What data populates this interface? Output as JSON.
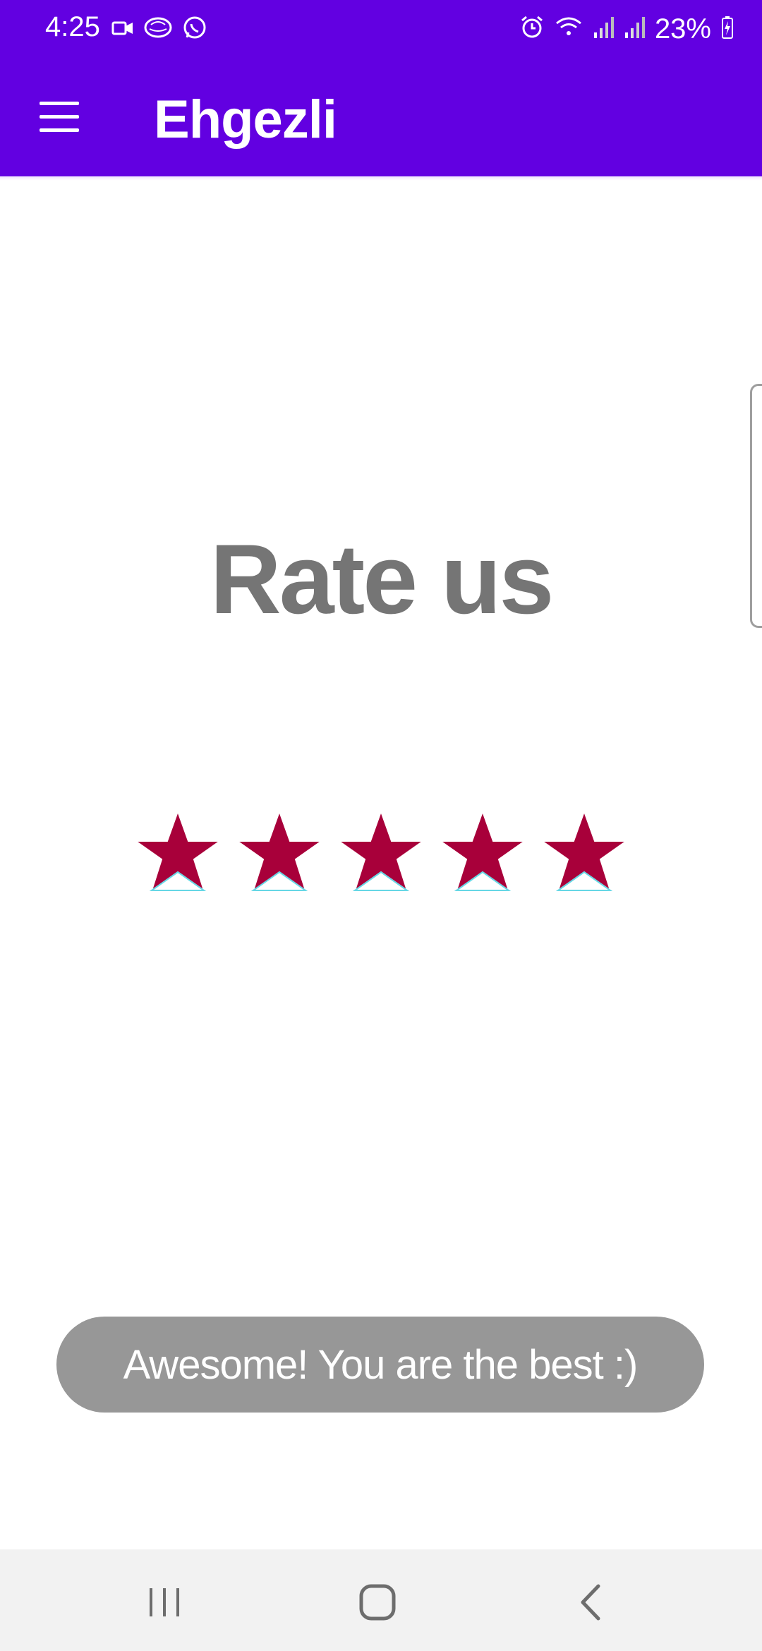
{
  "status_bar": {
    "time": "4:25",
    "left_icons": [
      "video-call-icon",
      "brain-app-icon",
      "whatsapp-icon"
    ],
    "right_icons": [
      "alarm-icon",
      "wifi-icon",
      "signal-icon",
      "signal-icon",
      "battery-charging-icon"
    ],
    "battery": "23%"
  },
  "app_bar": {
    "title": "Ehgezli",
    "menu_icon": "hamburger-menu-icon",
    "background": "#6200e1"
  },
  "main": {
    "heading": "Rate us",
    "rating": {
      "value": 5,
      "max": 5,
      "star_color": "#a8003a"
    },
    "toast": "Awesome! You are the best :)"
  },
  "nav_bar": {
    "buttons": [
      "recent-apps-icon",
      "home-icon",
      "back-icon"
    ]
  }
}
